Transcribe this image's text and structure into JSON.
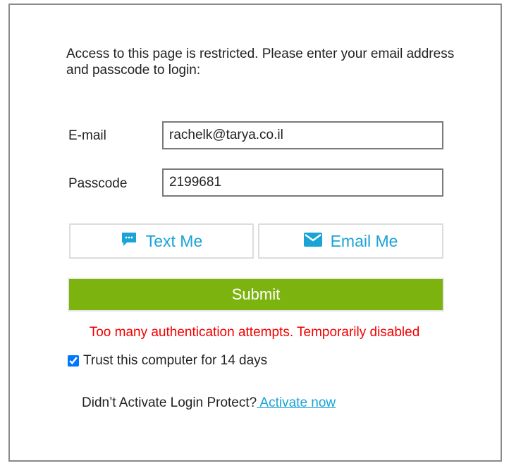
{
  "intro_text": "Access to this page is restricted. Please enter your email address and passcode to login:",
  "email": {
    "label": "E-mail",
    "value": "rachelk@tarya.co.il"
  },
  "passcode": {
    "label": "Passcode",
    "value": "2199681"
  },
  "text_me": {
    "label": "Text Me",
    "icon": "chat-bubble-icon"
  },
  "email_me": {
    "label": "Email Me",
    "icon": "envelope-icon"
  },
  "submit_label": "Submit",
  "error_message": "Too many authentication attempts. Temporarily disabled",
  "trust": {
    "label": "Trust this computer for 14 days",
    "checked": true
  },
  "activate": {
    "prompt": "Didn’t Activate Login Protect?",
    "link": " Activate now"
  },
  "colors": {
    "accent": "#1aa3d6",
    "submit": "#7cb30e",
    "error": "#f40000"
  }
}
